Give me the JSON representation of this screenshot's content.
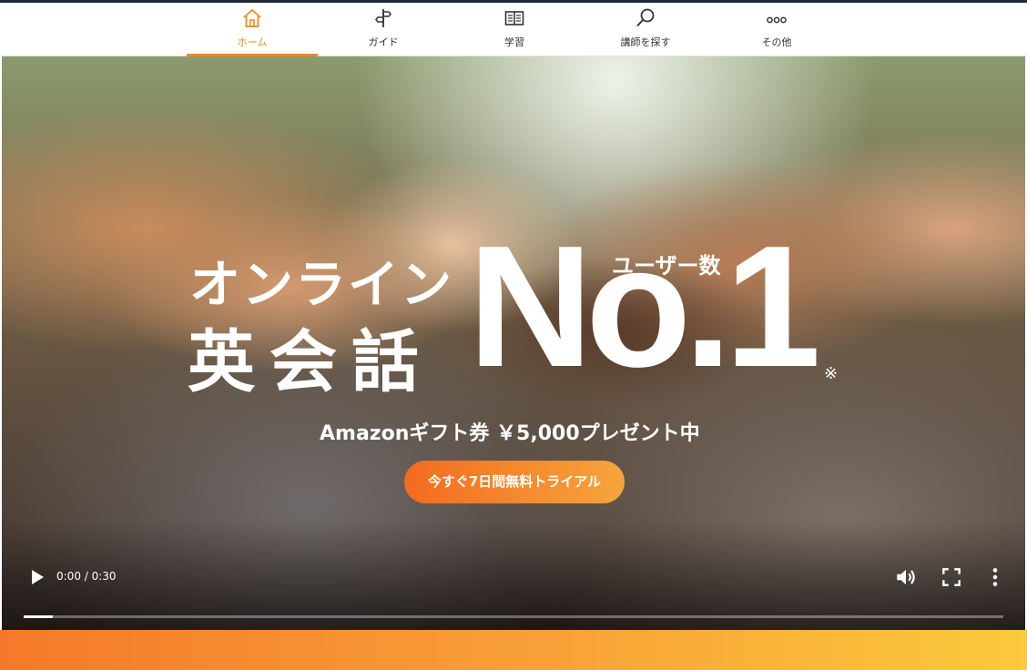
{
  "nav": {
    "items": [
      {
        "label": "ホーム",
        "icon": "home-icon",
        "active": true
      },
      {
        "label": "ガイド",
        "icon": "signpost-icon",
        "active": false
      },
      {
        "label": "学習",
        "icon": "book-icon",
        "active": false
      },
      {
        "label": "講師を探す",
        "icon": "search-icon",
        "active": false
      },
      {
        "label": "その他",
        "icon": "more-icon",
        "active": false
      }
    ]
  },
  "hero": {
    "line1": "オンライン",
    "line2": "英会話",
    "rank": "No.1",
    "rank_prefix": "ユーザー数",
    "note_mark": "※",
    "gift_text": "Amazonギフト券 ￥5,000プレゼント中",
    "cta_label": "今すぐ7日間無料トライアル"
  },
  "player": {
    "time": "0:00 / 0:30",
    "progress": 0.03
  },
  "colors": {
    "accent": "#f08a1c",
    "cta_start": "#f36b1f",
    "cta_end": "#f6a53b",
    "band_start": "#f5792a",
    "band_end": "#fbc93b"
  }
}
